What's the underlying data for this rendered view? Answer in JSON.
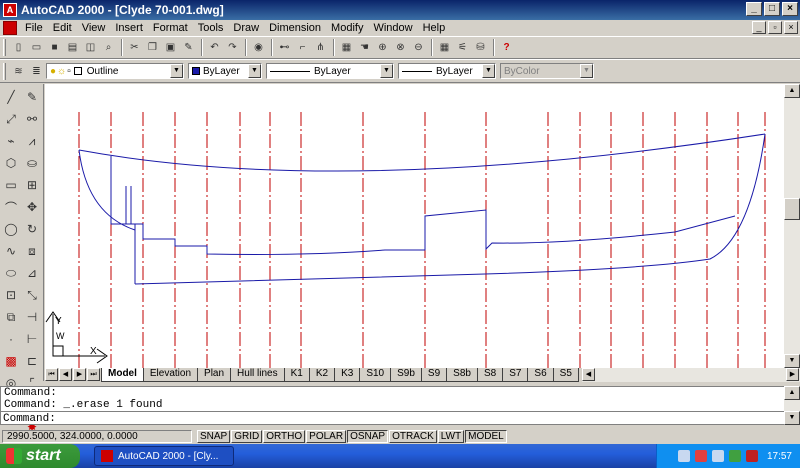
{
  "window": {
    "title": "AutoCAD 2000 - [Clyde 70-001.dwg]",
    "controls": {
      "minimize": "_",
      "maximize": "□",
      "close": "×"
    }
  },
  "menu": [
    "File",
    "Edit",
    "View",
    "Insert",
    "Format",
    "Tools",
    "Draw",
    "Dimension",
    "Modify",
    "Window",
    "Help"
  ],
  "standard_toolbar": {
    "icons": [
      "new-icon",
      "open-icon",
      "save-icon",
      "print-icon",
      "preview-icon",
      "find-icon",
      "cut-icon",
      "copy-icon",
      "paste-icon",
      "matchprop-icon",
      "undo-icon",
      "redo-icon",
      "browser-icon",
      "snap-icon",
      "ucs-icon",
      "tree-icon",
      "redraw-icon",
      "pan-icon",
      "zoom-icon",
      "zoom-window-icon",
      "zoom-prev-icon",
      "properties-icon",
      "designcenter-icon",
      "dbconnect-icon",
      "help-icon"
    ]
  },
  "properties_toolbar": {
    "layer_name": "Outline",
    "color_value": "ByLayer",
    "linetype_value": "ByLayer",
    "lineweight_value": "ByLayer",
    "plotstyle_value": "ByColor"
  },
  "palette": {
    "draw_tools": [
      "line-icon",
      "construction-line-icon",
      "polyline-icon",
      "polygon-icon",
      "rectangle-icon",
      "arc-icon",
      "circle-icon",
      "spline-icon",
      "ellipse-icon",
      "insert-block-icon",
      "make-block-icon",
      "point-icon",
      "hatch-icon",
      "region-icon",
      "text-icon"
    ],
    "modify_tools": [
      "erase-icon",
      "copy-object-icon",
      "mirror-icon",
      "offset-icon",
      "array-icon",
      "move-icon",
      "rotate-icon",
      "scale-icon",
      "stretch-icon",
      "lengthen-icon",
      "trim-icon",
      "extend-icon",
      "break-icon",
      "chamfer-icon",
      "fillet-icon",
      "explode-icon"
    ]
  },
  "drawing": {
    "ucs_labels": {
      "x": "X",
      "y": "Y",
      "w": "W"
    },
    "colors": {
      "station_lines": "#c00000",
      "hull": "#1a1aa8",
      "background": "#ffffff"
    }
  },
  "tabs": [
    "Model",
    "Elevation",
    "Plan",
    "Hull lines",
    "K1",
    "K2",
    "K3",
    "S10",
    "S9b",
    "S9",
    "S8b",
    "S8",
    "S7",
    "S6",
    "S5"
  ],
  "active_tab": "Model",
  "command": {
    "lines": [
      "Command:",
      "Command: _.erase 1 found"
    ],
    "prompt": "Command:"
  },
  "status": {
    "coordinates": "2990.5000, 324.0000, 0.0000",
    "modes": [
      "SNAP",
      "GRID",
      "ORTHO",
      "POLAR",
      "OSNAP",
      "OTRACK",
      "LWT",
      "MODEL"
    ]
  },
  "taskbar": {
    "start_label": "start",
    "task_label": "AutoCAD 2000 - [Cly...",
    "clock": "17:57"
  }
}
